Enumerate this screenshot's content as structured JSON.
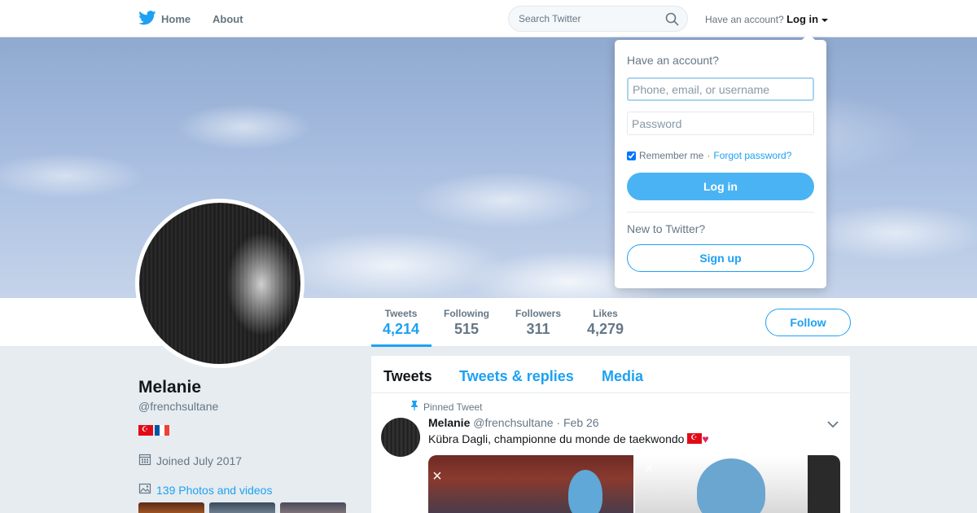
{
  "nav": {
    "home_label": "Home",
    "about_label": "About",
    "search_placeholder": "Search Twitter",
    "have_account_text": "Have an account?",
    "login_toggle_label": "Log in"
  },
  "profile": {
    "name": "Melanie",
    "handle": "@frenchsultane",
    "flags": [
      "turkey-flag",
      "france-flag"
    ],
    "joined": "Joined July 2017",
    "photos_link": "139 Photos and videos"
  },
  "stats": {
    "tweets": {
      "label": "Tweets",
      "value": "4,214"
    },
    "following": {
      "label": "Following",
      "value": "515"
    },
    "followers": {
      "label": "Followers",
      "value": "311"
    },
    "likes": {
      "label": "Likes",
      "value": "4,279"
    }
  },
  "follow_label": "Follow",
  "timeline": {
    "tabs": [
      "Tweets",
      "Tweets & replies",
      "Media"
    ],
    "pinned_label": "Pinned Tweet",
    "tweet": {
      "name": "Melanie",
      "handle": "@frenchsultane",
      "separator": "·",
      "date": "Feb 26",
      "text": "Kübra Dagli, championne du monde de taekwondo"
    }
  },
  "login_dropdown": {
    "title": "Have an account?",
    "username_placeholder": "Phone, email, or username",
    "password_placeholder": "Password",
    "remember_label": "Remember me",
    "separator": "·",
    "forgot_label": "Forgot password?",
    "login_button": "Log in",
    "new_text": "New to Twitter?",
    "signup_button": "Sign up"
  },
  "colors": {
    "accent": "#1da1f2",
    "login_button": "#4ab3f4",
    "background": "#e6ecf0"
  }
}
